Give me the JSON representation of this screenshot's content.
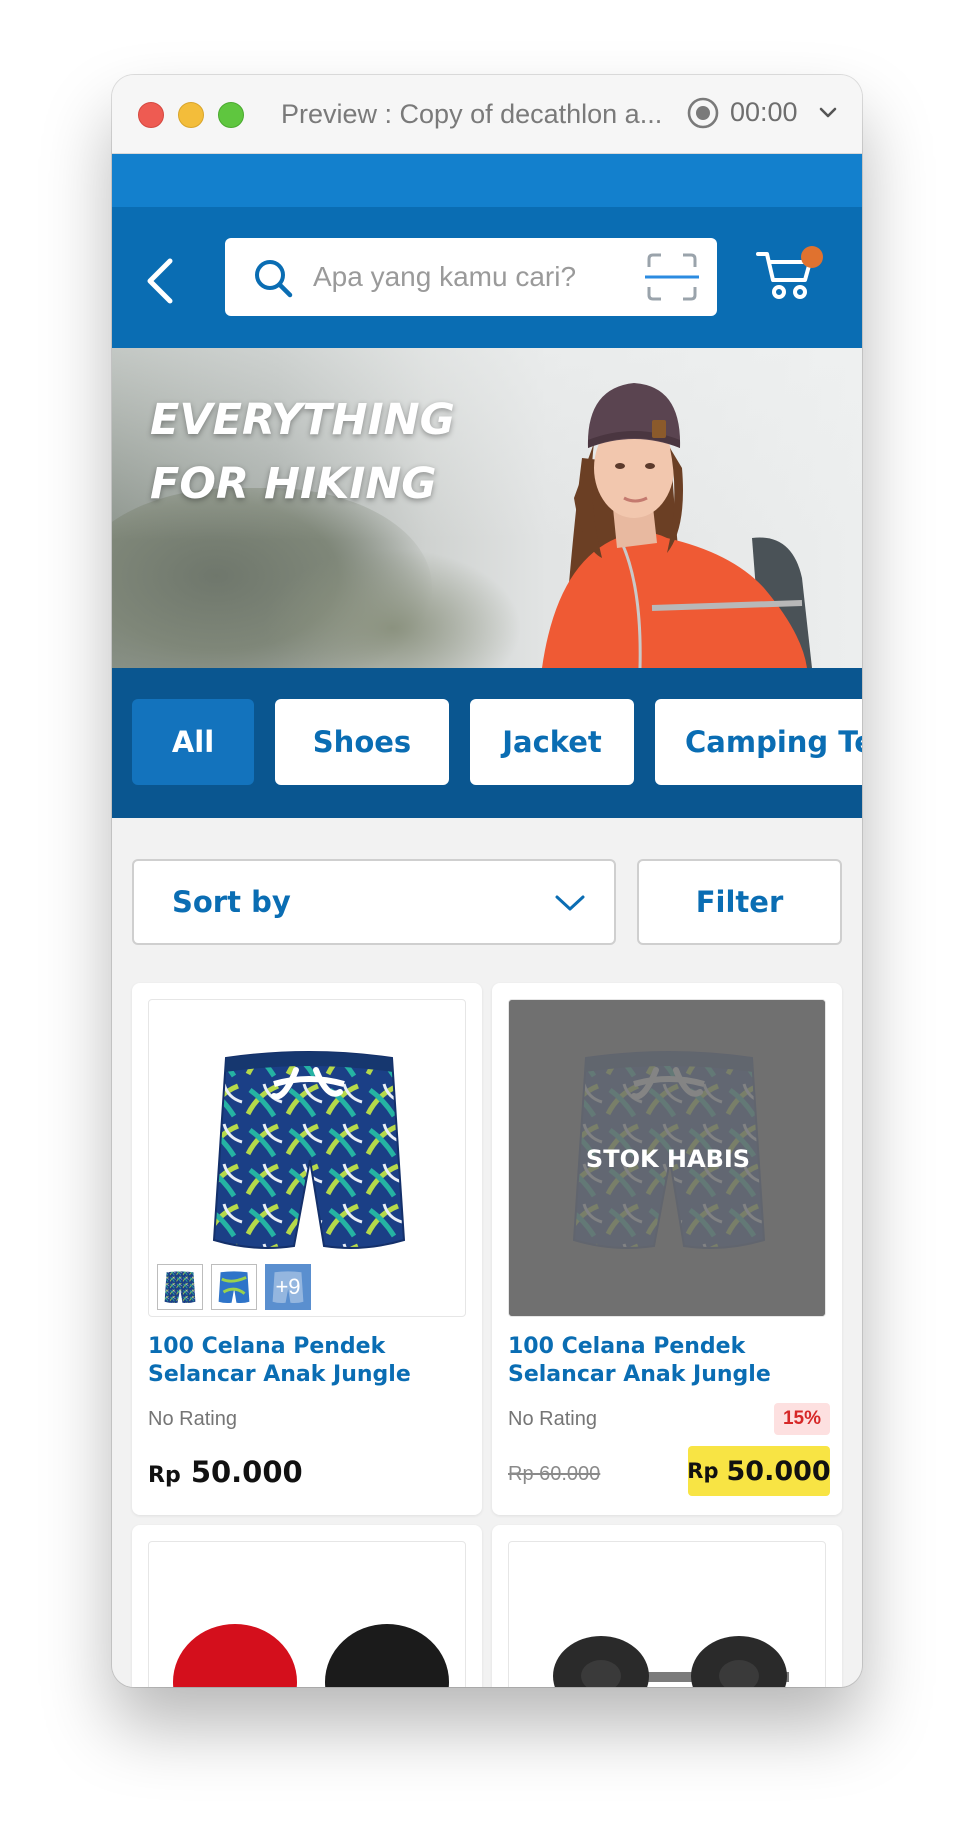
{
  "window": {
    "title": "Preview : Copy of decathlon a...",
    "timer": "00:00"
  },
  "search": {
    "placeholder": "Apa yang kamu cari?"
  },
  "banner": {
    "line1": "EVERYTHING",
    "line2": "FOR HIKING"
  },
  "categories": [
    {
      "label": "All",
      "active": true
    },
    {
      "label": "Shoes",
      "active": false
    },
    {
      "label": "Jacket",
      "active": false
    },
    {
      "label": "Camping Tent",
      "active": false
    }
  ],
  "sort": {
    "label": "Sort by"
  },
  "filter": {
    "label": "Filter"
  },
  "products": [
    {
      "name": "100 Celana Pendek Selancar Anak Jungle",
      "rating": "No Rating",
      "currency": "Rp",
      "price": "50.000",
      "more_variants": "+9"
    },
    {
      "name": "100 Celana Pendek Selancar Anak Jungle",
      "rating": "No Rating",
      "stock_status": "STOK HABIS",
      "discount": "15%",
      "old_price": "Rp 60.000",
      "currency": "Rp",
      "price": "50.000"
    }
  ],
  "colors": {
    "brand_blue": "#0a6db3",
    "status_bar": "#1380cd",
    "category_bar": "#0a5690",
    "cart_badge": "#e0722f",
    "sale_price_bg": "#f8e444",
    "discount_text": "#d62828"
  },
  "icons": {
    "back": "chevron-left-icon",
    "search": "search-icon",
    "scan": "barcode-scan-icon",
    "cart": "cart-icon",
    "sort": "chevron-down-icon",
    "record": "record-icon"
  }
}
